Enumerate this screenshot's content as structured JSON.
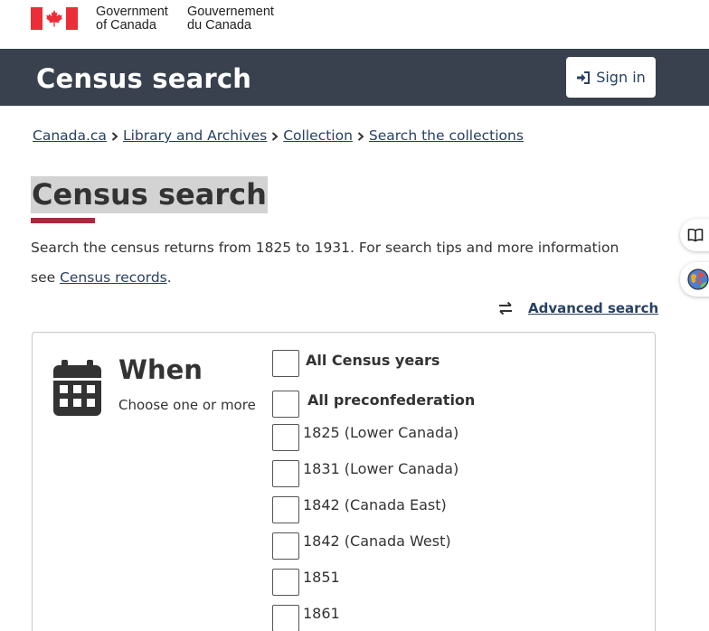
{
  "gov": {
    "en_line1": "Government",
    "en_line2": "of Canada",
    "fr_line1": "Gouvernement",
    "fr_line2": "du Canada",
    "flag_color": "#eb2d37"
  },
  "banner": {
    "title": "Census search",
    "signin_label": "Sign in",
    "background": "#38414d"
  },
  "breadcrumb": [
    "Canada.ca",
    "Library and Archives",
    "Collection",
    "Search the collections"
  ],
  "page": {
    "title": "Census search",
    "intro_text": "Search the census returns from 1825 to 1931. For search tips and more information see ",
    "intro_link": "Census records",
    "intro_end": ".",
    "advanced_search": "Advanced search",
    "accent": "#a62a3d"
  },
  "side_buttons": [
    "book-icon",
    "globe-icon"
  ],
  "when": {
    "title": "When",
    "subtitle": "Choose one or more",
    "options": [
      {
        "label": "All Census years",
        "bold": true,
        "checked": false
      },
      {
        "label": "All preconfederation",
        "bold": true,
        "checked": false
      },
      {
        "label": "1825 (Lower Canada)",
        "bold": false,
        "checked": false
      },
      {
        "label": "1831 (Lower Canada)",
        "bold": false,
        "checked": false
      },
      {
        "label": "1842 (Canada East)",
        "bold": false,
        "checked": false
      },
      {
        "label": "1842 (Canada West)",
        "bold": false,
        "checked": false
      },
      {
        "label": "1851",
        "bold": false,
        "checked": false
      },
      {
        "label": "1861",
        "bold": false,
        "checked": false
      }
    ]
  }
}
